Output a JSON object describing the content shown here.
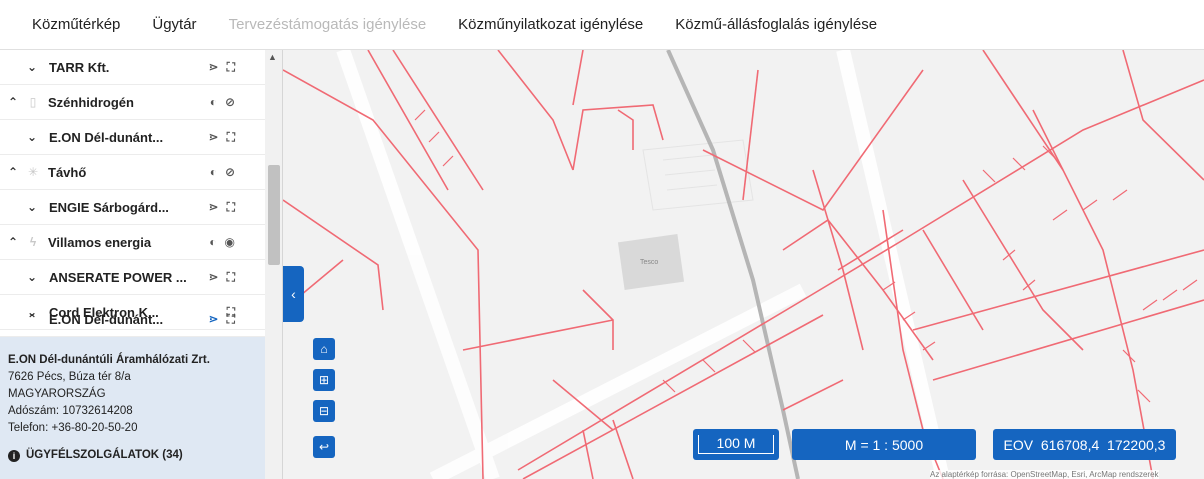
{
  "nav": {
    "tabs": [
      {
        "label": "Közműtérkép"
      },
      {
        "label": "Ügytár"
      },
      {
        "label": "Tervezéstámogatás igénylése"
      },
      {
        "label": "Közműnyilatkozat igénylése"
      },
      {
        "label": "Közmű-állásfoglalás igénylése"
      }
    ]
  },
  "layers": {
    "rows": [
      {
        "label": "TARR Kft."
      },
      {
        "label": "Szénhidrogén"
      },
      {
        "label": "E.ON Dél-dunánt..."
      },
      {
        "label": "Távhő"
      },
      {
        "label": "ENGIE Sárbogárd..."
      },
      {
        "label": "Villamos energia"
      },
      {
        "label": "ANSERATE POWER ..."
      },
      {
        "label": "Cord Elektron K..."
      },
      {
        "label": "E.ON Dél-dunánt..."
      }
    ]
  },
  "details": {
    "company": "E.ON Dél-dunántúli Áramhálózati Zrt.",
    "address": "7626 Pécs, Búza tér 8/a",
    "country": "MAGYARORSZÁG",
    "tax": "Adószám: 10732614208",
    "phone": "Telefon: +36-80-20-50-20",
    "services": "ÜGYFÉLSZOLGÁLATOK (34)"
  },
  "map": {
    "building_label": "Tesco",
    "scale_label": "100 M",
    "ratio_label": "M = 1 : 5000",
    "coords_label": "EOV  616708,4  172200,3",
    "attribution": "Az alaptérkép forrása: OpenStreetMap, Esri, ArcMap rendszerek"
  },
  "icons": {
    "expand": "chevron-down-icon",
    "collapse": "chevron-up-icon",
    "share": "share-icon",
    "fullscreen": "fullscreen-icon",
    "contrast": "contrast-icon",
    "hidden": "eye-off-icon",
    "visible": "eye-icon",
    "home": "home-icon",
    "zoom_in": "zoom-in-icon",
    "zoom_out": "zoom-out-icon",
    "back": "back-icon"
  },
  "colors": {
    "primary": "#1565c0",
    "network_line": "#f06a74",
    "panel_bg": "#dfe8f3"
  }
}
